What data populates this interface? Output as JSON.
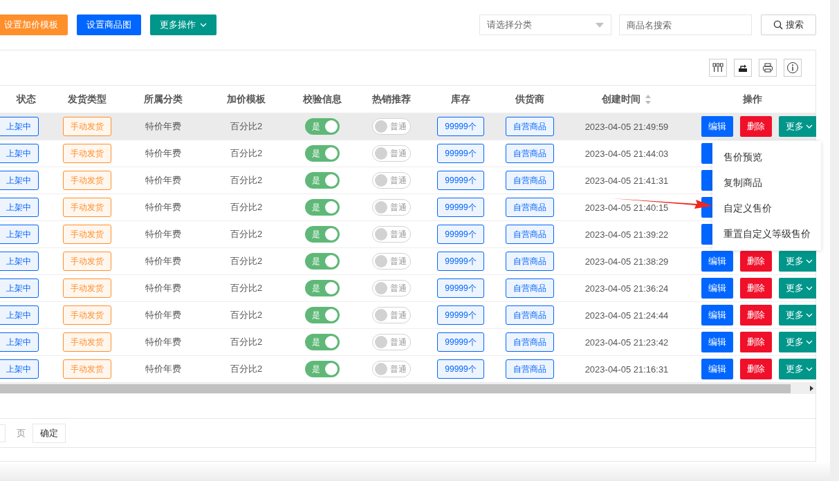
{
  "toolbar": {
    "buttons": [
      {
        "kind": "orange",
        "label": "设置加价模板"
      },
      {
        "kind": "blue",
        "label": "设置商品图"
      },
      {
        "kind": "dropdown",
        "label": "更多操作"
      }
    ],
    "category_select": {
      "placeholder": "请选择分类"
    },
    "search": {
      "placeholder": "商品名搜索"
    },
    "search_button": "搜索"
  },
  "table": {
    "columns": [
      {
        "label": "状态"
      },
      {
        "label": "发货类型"
      },
      {
        "label": "所属分类"
      },
      {
        "label": "加价模板"
      },
      {
        "label": "校验信息"
      },
      {
        "label": "热销推荐"
      },
      {
        "label": "库存"
      },
      {
        "label": "供货商"
      },
      {
        "label": "创建时间",
        "sortable": true
      },
      {
        "label": "操作"
      }
    ],
    "rows": [
      {
        "highlighted": true,
        "status": "上架中",
        "shipping": "手动发货",
        "category": "特价年费",
        "template": "百分比2",
        "verify": {
          "on": true,
          "label": "是"
        },
        "hot": {
          "on": false,
          "label": "普通"
        },
        "stock": "99999个",
        "supplier": "自营商品",
        "created": "2023-04-05 21:49:59",
        "actions": [
          {
            "kind": "edit",
            "label": "编辑"
          },
          {
            "kind": "delete",
            "label": "删除"
          },
          {
            "kind": "more",
            "label": "更多"
          }
        ]
      },
      {
        "highlighted": false,
        "status": "上架中",
        "shipping": "手动发货",
        "category": "特价年费",
        "template": "百分比2",
        "verify": {
          "on": true,
          "label": "是"
        },
        "hot": {
          "on": false,
          "label": "普通"
        },
        "stock": "99999个",
        "supplier": "自营商品",
        "created": "2023-04-05 21:44:03"
      },
      {
        "highlighted": false,
        "status": "上架中",
        "shipping": "手动发货",
        "category": "特价年费",
        "template": "百分比2",
        "verify": {
          "on": true,
          "label": "是"
        },
        "hot": {
          "on": false,
          "label": "普通"
        },
        "stock": "99999个",
        "supplier": "自营商品",
        "created": "2023-04-05 21:41:31"
      },
      {
        "highlighted": false,
        "status": "上架中",
        "shipping": "手动发货",
        "category": "特价年费",
        "template": "百分比2",
        "verify": {
          "on": true,
          "label": "是"
        },
        "hot": {
          "on": false,
          "label": "普通"
        },
        "stock": "99999个",
        "supplier": "自营商品",
        "created": "2023-04-05 21:40:15"
      },
      {
        "highlighted": false,
        "status": "上架中",
        "shipping": "手动发货",
        "category": "特价年费",
        "template": "百分比2",
        "verify": {
          "on": true,
          "label": "是"
        },
        "hot": {
          "on": false,
          "label": "普通"
        },
        "stock": "99999个",
        "supplier": "自营商品",
        "created": "2023-04-05 21:39:22"
      },
      {
        "highlighted": false,
        "status": "上架中",
        "shipping": "手动发货",
        "category": "特价年费",
        "template": "百分比2",
        "verify": {
          "on": true,
          "label": "是"
        },
        "hot": {
          "on": false,
          "label": "普通"
        },
        "stock": "99999个",
        "supplier": "自营商品",
        "created": "2023-04-05 21:38:29",
        "actions": [
          {
            "kind": "edit",
            "label": "编辑"
          },
          {
            "kind": "delete",
            "label": "删除"
          },
          {
            "kind": "more",
            "label": "更多"
          }
        ]
      },
      {
        "highlighted": false,
        "status": "上架中",
        "shipping": "手动发货",
        "category": "特价年费",
        "template": "百分比2",
        "verify": {
          "on": true,
          "label": "是"
        },
        "hot": {
          "on": false,
          "label": "普通"
        },
        "stock": "99999个",
        "supplier": "自营商品",
        "created": "2023-04-05 21:36:24",
        "actions": [
          {
            "kind": "edit",
            "label": "编辑"
          },
          {
            "kind": "delete",
            "label": "删除"
          },
          {
            "kind": "more",
            "label": "更多"
          }
        ]
      },
      {
        "highlighted": false,
        "status": "上架中",
        "shipping": "手动发货",
        "category": "特价年费",
        "template": "百分比2",
        "verify": {
          "on": true,
          "label": "是"
        },
        "hot": {
          "on": false,
          "label": "普通"
        },
        "stock": "99999个",
        "supplier": "自营商品",
        "created": "2023-04-05 21:24:44",
        "actions": [
          {
            "kind": "edit",
            "label": "编辑"
          },
          {
            "kind": "delete",
            "label": "删除"
          },
          {
            "kind": "more",
            "label": "更多"
          }
        ]
      },
      {
        "highlighted": false,
        "status": "上架中",
        "shipping": "手动发货",
        "category": "特价年费",
        "template": "百分比2",
        "verify": {
          "on": true,
          "label": "是"
        },
        "hot": {
          "on": false,
          "label": "普通"
        },
        "stock": "99999个",
        "supplier": "自营商品",
        "created": "2023-04-05 21:23:42",
        "actions": [
          {
            "kind": "edit",
            "label": "编辑"
          },
          {
            "kind": "delete",
            "label": "删除"
          },
          {
            "kind": "more",
            "label": "更多"
          }
        ]
      },
      {
        "highlighted": false,
        "status": "上架中",
        "shipping": "手动发货",
        "category": "特价年费",
        "template": "百分比2",
        "verify": {
          "on": true,
          "label": "是"
        },
        "hot": {
          "on": false,
          "label": "普通"
        },
        "stock": "99999个",
        "supplier": "自营商品",
        "created": "2023-04-05 21:16:31",
        "actions": [
          {
            "kind": "edit",
            "label": "编辑"
          },
          {
            "kind": "delete",
            "label": "删除"
          },
          {
            "kind": "more",
            "label": "更多"
          }
        ]
      }
    ]
  },
  "more_menu": {
    "items": [
      {
        "label": "售价预览"
      },
      {
        "label": "复制商品"
      },
      {
        "label": "自定义售价"
      },
      {
        "label": "重置自定义等级售价"
      }
    ]
  },
  "pagination": {
    "page_suffix": "页",
    "confirm": "确定"
  }
}
